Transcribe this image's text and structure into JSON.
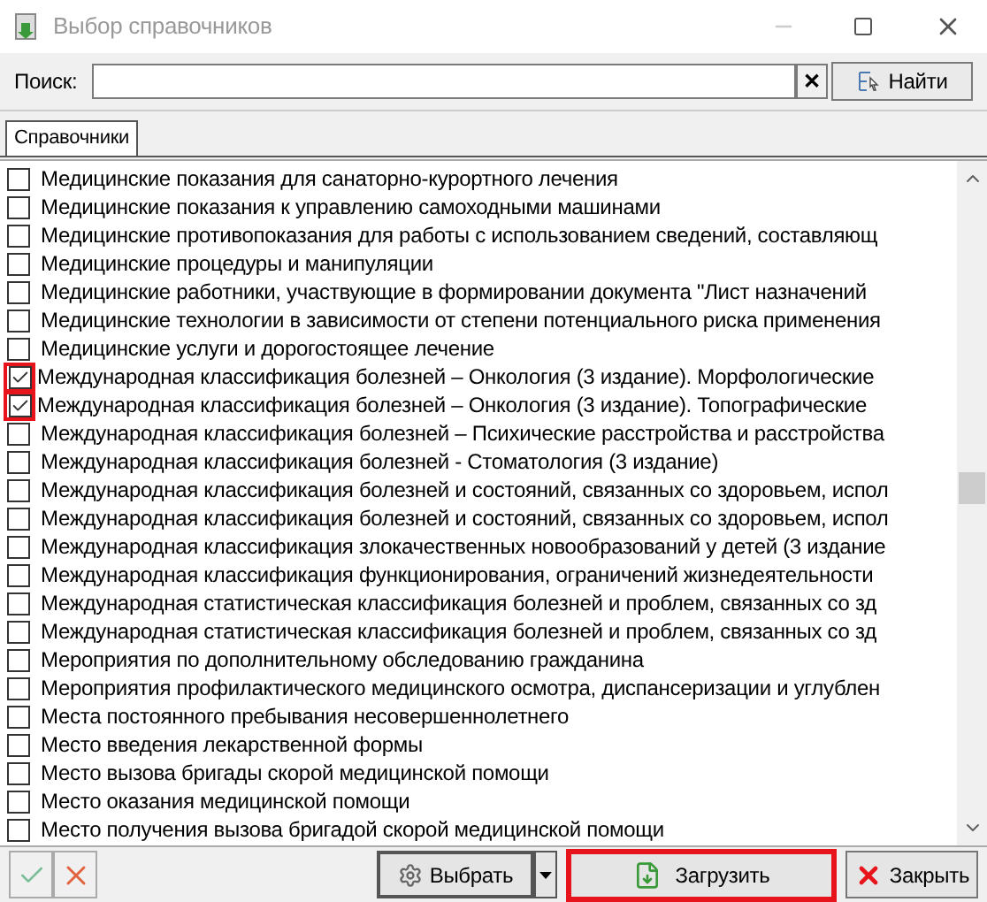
{
  "window": {
    "title": "Выбор справочников"
  },
  "search": {
    "label": "Поиск:",
    "clear": "✕",
    "button": "Найти"
  },
  "tabs": [
    {
      "label": "Справочники",
      "selected": true
    }
  ],
  "items": [
    {
      "label": "Медицинские показания для санаторно-курортного лечения",
      "checked": false,
      "highlighted": false
    },
    {
      "label": "Медицинские показания к управлению самоходными машинами",
      "checked": false,
      "highlighted": false
    },
    {
      "label": "Медицинские противопоказания для работы с использованием сведений, составляющ",
      "checked": false,
      "highlighted": false
    },
    {
      "label": "Медицинские процедуры и манипуляции",
      "checked": false,
      "highlighted": false
    },
    {
      "label": "Медицинские работники, участвующие в формировании документа \"Лист назначений",
      "checked": false,
      "highlighted": false
    },
    {
      "label": "Медицинские технологии в зависимости от степени потенциального риска применения",
      "checked": false,
      "highlighted": false
    },
    {
      "label": "Медицинские услуги и дорогостоящее лечение",
      "checked": false,
      "highlighted": false
    },
    {
      "label": "Международная классификация болезней – Онкология (3 издание). Морфологические",
      "checked": true,
      "highlighted": true
    },
    {
      "label": "Международная классификация болезней – Онкология (3 издание). Топографические",
      "checked": true,
      "highlighted": true
    },
    {
      "label": "Международная классификация болезней – Психические расстройства и расстройства",
      "checked": false,
      "highlighted": false
    },
    {
      "label": "Международная классификация болезней - Стоматология (3 издание)",
      "checked": false,
      "highlighted": false
    },
    {
      "label": "Международная классификация болезней и состояний, связанных со здоровьем, испол",
      "checked": false,
      "highlighted": false
    },
    {
      "label": "Международная классификация болезней и состояний, связанных со здоровьем, испол",
      "checked": false,
      "highlighted": false
    },
    {
      "label": "Международная классификация злокачественных новообразований у детей (3 издание",
      "checked": false,
      "highlighted": false
    },
    {
      "label": "Международная классификация функционирования, ограничений жизнедеятельности",
      "checked": false,
      "highlighted": false
    },
    {
      "label": "Международная статистическая классификация болезней и проблем, связанных со зд",
      "checked": false,
      "highlighted": false
    },
    {
      "label": "Международная статистическая классификация болезней и проблем, связанных со зд",
      "checked": false,
      "highlighted": false
    },
    {
      "label": "Мероприятия по дополнительному обследованию гражданина",
      "checked": false,
      "highlighted": false
    },
    {
      "label": "Мероприятия профилактического медицинского осмотра, диспансеризации и углублен",
      "checked": false,
      "highlighted": false
    },
    {
      "label": "Места постоянного пребывания несовершеннолетнего",
      "checked": false,
      "highlighted": false
    },
    {
      "label": "Место введения лекарственной формы",
      "checked": false,
      "highlighted": false
    },
    {
      "label": "Место вызова бригады скорой медицинской помощи",
      "checked": false,
      "highlighted": false
    },
    {
      "label": "Место оказания медицинской помощи",
      "checked": false,
      "highlighted": false
    },
    {
      "label": "Место получения вызова бригадой скорой медицинской помощи",
      "checked": false,
      "highlighted": false
    }
  ],
  "footer": {
    "select": "Выбрать",
    "load": {
      "label": "Загрузить",
      "highlighted": true
    },
    "close": "Закрыть"
  }
}
